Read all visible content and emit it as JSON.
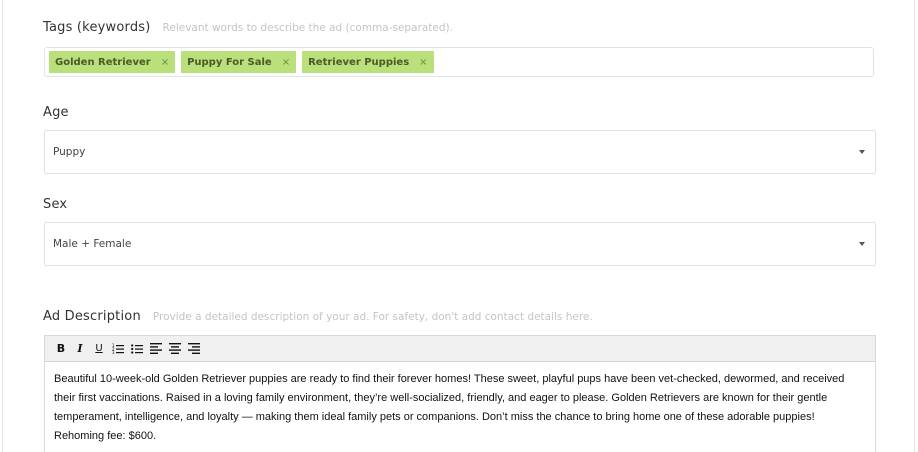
{
  "tags_field": {
    "label": "Tags (keywords)",
    "hint": "Relevant words to describe the ad (comma-separated).",
    "tags": [
      {
        "text": "Golden Retriever",
        "remove": "×"
      },
      {
        "text": "Puppy For Sale",
        "remove": "×"
      },
      {
        "text": "Retriever Puppies",
        "remove": "×"
      }
    ]
  },
  "age_field": {
    "label": "Age",
    "value": "Puppy"
  },
  "sex_field": {
    "label": "Sex",
    "value": "Male + Female"
  },
  "description_field": {
    "label": "Ad Description",
    "hint": "Provide a detailed description of your ad. For safety, don't add contact details here.",
    "toolbar": {
      "bold": "B",
      "italic": "I",
      "underline": "U"
    },
    "content": "Beautiful 10-week-old Golden Retriever puppies are ready to find their forever homes! These sweet, playful pups have been vet-checked, dewormed, and received their first vaccinations. Raised in a loving family environment, they’re well-socialized, friendly, and eager to please. Golden Retrievers are known for their gentle temperament, intelligence, and loyalty — making them ideal family pets or companions. Don’t miss the chance to bring home one of these adorable puppies! Rehoming fee: $600."
  },
  "colors": {
    "tag_background": "#b9e07a",
    "hint_text": "#c4c4c4",
    "toolbar_background": "#f0f0f0"
  }
}
